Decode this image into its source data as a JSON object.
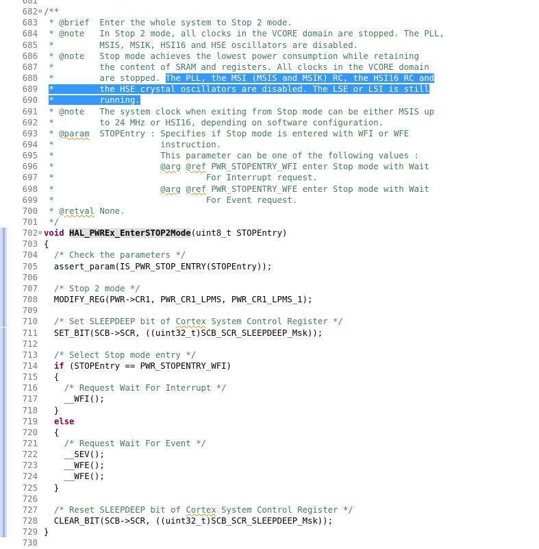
{
  "editor": {
    "lines": [
      {
        "n": "681",
        "mod": false,
        "fold": "",
        "s": []
      },
      {
        "n": "682",
        "mod": false,
        "fold": "⊖",
        "s": [
          [
            "cm",
            "/**"
          ]
        ]
      },
      {
        "n": "683",
        "mod": false,
        "fold": "",
        "s": [
          [
            "cm",
            " * @brief  Enter the whole system to Stop 2 mode."
          ]
        ]
      },
      {
        "n": "684",
        "mod": false,
        "fold": "",
        "s": [
          [
            "cm",
            " * @note   In Stop 2 mode, all clocks in the VCORE domain are stopped. The PLL,"
          ]
        ]
      },
      {
        "n": "685",
        "mod": false,
        "fold": "",
        "s": [
          [
            "cm",
            " *         MSIS, MSIK, HSI16 and HSE oscillators are disabled."
          ]
        ]
      },
      {
        "n": "686",
        "mod": false,
        "fold": "",
        "s": [
          [
            "cm",
            " * @note   Stop mode achieves the lowest power consumption while retaining"
          ]
        ]
      },
      {
        "n": "687",
        "mod": false,
        "fold": "",
        "s": [
          [
            "cm",
            " *         the content of SRAM and registers. All clocks in the VCORE domain"
          ]
        ]
      },
      {
        "n": "688",
        "mod": false,
        "fold": "",
        "s": [
          [
            "cm",
            " *         are stopped. "
          ],
          [
            "sel",
            "The PLL, the MSI (MSIS and MSIK) RC, the HSI16 RC and"
          ]
        ]
      },
      {
        "n": "689",
        "mod": false,
        "fold": "",
        "s": [
          [
            "cm",
            " "
          ],
          [
            "sel",
            "*         the HSE crystal oscillators are disabled. The LSE or LSI is still"
          ]
        ]
      },
      {
        "n": "690",
        "mod": false,
        "fold": "",
        "s": [
          [
            "cm",
            " "
          ],
          [
            "sel",
            "*         running."
          ]
        ]
      },
      {
        "n": "691",
        "mod": false,
        "fold": "",
        "s": [
          [
            "cm",
            " * @note   The system clock when exiting from Stop mode can be either MSIS up"
          ]
        ]
      },
      {
        "n": "692",
        "mod": false,
        "fold": "",
        "s": [
          [
            "cm",
            " *         to 24 MHz or HSI16, depending on software configuration."
          ]
        ]
      },
      {
        "n": "693",
        "mod": false,
        "fold": "",
        "s": [
          [
            "cm",
            " * "
          ],
          [
            "cm sq",
            "@param"
          ],
          [
            "cm",
            "  STOPEntry : Specifies if Stop mode is entered with WFI or WFE"
          ]
        ]
      },
      {
        "n": "694",
        "mod": false,
        "fold": "",
        "s": [
          [
            "cm",
            " *                     instruction."
          ]
        ]
      },
      {
        "n": "695",
        "mod": false,
        "fold": "",
        "s": [
          [
            "cm",
            " *                     This parameter can be one of the following values :"
          ]
        ]
      },
      {
        "n": "696",
        "mod": false,
        "fold": "",
        "s": [
          [
            "cm",
            " *                     "
          ],
          [
            "cm sq",
            "@arg"
          ],
          [
            "cm",
            " "
          ],
          [
            "cm sq",
            "@ref"
          ],
          [
            "cm",
            " PWR_STOPENTRY_WFI enter Stop mode with Wait"
          ]
        ]
      },
      {
        "n": "697",
        "mod": false,
        "fold": "",
        "s": [
          [
            "cm",
            " *                              For Interrupt request."
          ]
        ]
      },
      {
        "n": "698",
        "mod": false,
        "fold": "",
        "s": [
          [
            "cm",
            " *                     "
          ],
          [
            "cm sq",
            "@arg"
          ],
          [
            "cm",
            " "
          ],
          [
            "cm sq",
            "@ref"
          ],
          [
            "cm",
            " PWR_STOPENTRY_WFE enter Stop mode with Wait"
          ]
        ]
      },
      {
        "n": "699",
        "mod": false,
        "fold": "",
        "s": [
          [
            "cm",
            " *                              For Event request."
          ]
        ]
      },
      {
        "n": "700",
        "mod": false,
        "fold": "",
        "s": [
          [
            "cm",
            " * "
          ],
          [
            "cm sq",
            "@retval"
          ],
          [
            "cm",
            " None."
          ]
        ]
      },
      {
        "n": "701",
        "mod": false,
        "fold": "",
        "s": [
          [
            "cm",
            " */"
          ]
        ]
      },
      {
        "n": "702",
        "mod": true,
        "fold": "⊖",
        "s": [
          [
            "kw",
            "void"
          ],
          [
            "",
            " "
          ],
          [
            "fn",
            "HAL_PWREx_EnterSTOP2Mode"
          ],
          [
            "",
            "(uint8_t STOPEntry)"
          ]
        ]
      },
      {
        "n": "703",
        "mod": true,
        "fold": "",
        "s": [
          [
            "",
            "{"
          ]
        ]
      },
      {
        "n": "704",
        "mod": true,
        "fold": "",
        "s": [
          [
            "",
            "  "
          ],
          [
            "cm",
            "/* Check the parameters */"
          ]
        ]
      },
      {
        "n": "705",
        "mod": true,
        "fold": "",
        "s": [
          [
            "",
            "  assert_param(IS_PWR_STOP_ENTRY(STOPEntry));"
          ]
        ]
      },
      {
        "n": "706",
        "mod": true,
        "fold": "",
        "s": []
      },
      {
        "n": "707",
        "mod": true,
        "fold": "",
        "s": [
          [
            "",
            "  "
          ],
          [
            "cm",
            "/* Stop 2 mode */"
          ]
        ]
      },
      {
        "n": "708",
        "mod": true,
        "fold": "",
        "s": [
          [
            "",
            "  MODIFY_REG(PWR->CR1, PWR_CR1_LPMS, PWR_CR1_LPMS_1);"
          ]
        ]
      },
      {
        "n": "709",
        "mod": true,
        "fold": "",
        "s": []
      },
      {
        "n": "710",
        "mod": true,
        "fold": "",
        "s": [
          [
            "",
            "  "
          ],
          [
            "cm",
            "/* Set SLEEPDEEP bit of "
          ],
          [
            "cm sq",
            "Cortex"
          ],
          [
            "cm",
            " System Control Register */"
          ]
        ]
      },
      {
        "n": "711",
        "mod": true,
        "fold": "",
        "s": [
          [
            "",
            "  SET_BIT(SCB->SCR, ((uint32_t)SCB_SCR_SLEEPDEEP_Msk));"
          ]
        ]
      },
      {
        "n": "712",
        "mod": true,
        "fold": "",
        "s": []
      },
      {
        "n": "713",
        "mod": true,
        "fold": "",
        "s": [
          [
            "",
            "  "
          ],
          [
            "cm",
            "/* Select Stop mode entry */"
          ]
        ]
      },
      {
        "n": "714",
        "mod": true,
        "fold": "",
        "s": [
          [
            "",
            "  "
          ],
          [
            "kw",
            "if"
          ],
          [
            "",
            " (STOPEntry == PWR_STOPENTRY_WFI)"
          ]
        ]
      },
      {
        "n": "715",
        "mod": true,
        "fold": "",
        "s": [
          [
            "",
            "  {"
          ]
        ]
      },
      {
        "n": "716",
        "mod": true,
        "fold": "",
        "s": [
          [
            "",
            "    "
          ],
          [
            "cm",
            "/* Request Wait For Interrupt */"
          ]
        ]
      },
      {
        "n": "717",
        "mod": true,
        "fold": "",
        "s": [
          [
            "",
            "    __WFI();"
          ]
        ]
      },
      {
        "n": "718",
        "mod": true,
        "fold": "",
        "s": [
          [
            "",
            "  }"
          ]
        ]
      },
      {
        "n": "719",
        "mod": true,
        "fold": "",
        "s": [
          [
            "",
            "  "
          ],
          [
            "kw",
            "else"
          ]
        ]
      },
      {
        "n": "720",
        "mod": true,
        "fold": "",
        "s": [
          [
            "",
            "  {"
          ]
        ]
      },
      {
        "n": "721",
        "mod": true,
        "fold": "",
        "s": [
          [
            "",
            "    "
          ],
          [
            "cm",
            "/* Request Wait For Event */"
          ]
        ]
      },
      {
        "n": "722",
        "mod": true,
        "fold": "",
        "s": [
          [
            "",
            "    __SEV();"
          ]
        ]
      },
      {
        "n": "723",
        "mod": true,
        "fold": "",
        "s": [
          [
            "",
            "    __WFE();"
          ]
        ]
      },
      {
        "n": "724",
        "mod": true,
        "fold": "",
        "s": [
          [
            "",
            "    __WFE();"
          ]
        ]
      },
      {
        "n": "725",
        "mod": true,
        "fold": "",
        "s": [
          [
            "",
            "  }"
          ]
        ]
      },
      {
        "n": "726",
        "mod": true,
        "fold": "",
        "s": []
      },
      {
        "n": "727",
        "mod": true,
        "fold": "",
        "s": [
          [
            "",
            "  "
          ],
          [
            "cm",
            "/* Reset SLEEPDEEP bit of "
          ],
          [
            "cm sq",
            "Cortex"
          ],
          [
            "cm",
            " System Control Register */"
          ]
        ]
      },
      {
        "n": "728",
        "mod": true,
        "fold": "",
        "s": [
          [
            "",
            "  CLEAR_BIT(SCB->SCR, ((uint32_t)SCB_SCR_SLEEPDEEP_Msk));"
          ]
        ]
      },
      {
        "n": "729",
        "mod": true,
        "fold": "",
        "s": [
          [
            "",
            "}"
          ]
        ]
      },
      {
        "n": "730",
        "mod": false,
        "fold": "",
        "s": []
      }
    ]
  },
  "colors": {
    "comment": "#3f7f5f",
    "keyword": "#7f0055",
    "selection": "#3399ff",
    "line_number": "#7a7a7a",
    "change_ruler": "#9db4dc"
  }
}
